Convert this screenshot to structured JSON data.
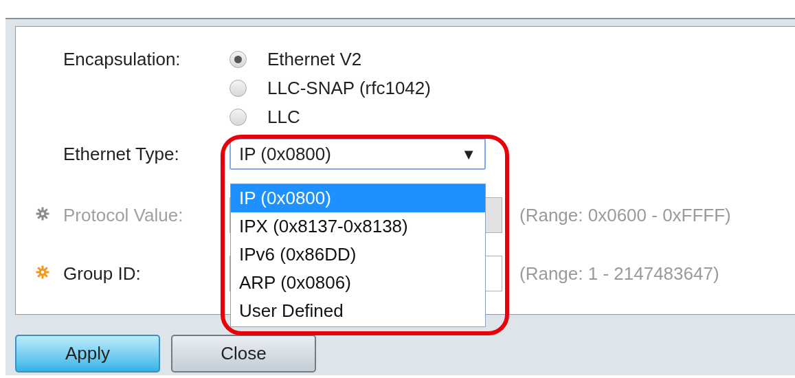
{
  "form": {
    "encapsulation": {
      "label": "Encapsulation:",
      "options": [
        {
          "label": "Ethernet V2",
          "selected": true
        },
        {
          "label": "LLC-SNAP (rfc1042)",
          "selected": false
        },
        {
          "label": "LLC",
          "selected": false
        }
      ]
    },
    "ethernet_type": {
      "label": "Ethernet Type:",
      "value": "IP (0x0800)",
      "arrow": "▼",
      "expanded": true,
      "options": [
        {
          "label": "IP (0x0800)",
          "selected": true
        },
        {
          "label": "IPX (0x8137-0x8138)",
          "selected": false
        },
        {
          "label": "IPv6 (0x86DD)",
          "selected": false
        },
        {
          "label": "ARP (0x0806)",
          "selected": false
        },
        {
          "label": "User Defined",
          "selected": false
        }
      ]
    },
    "fields": [
      {
        "label": "Protocol Value:",
        "required": true,
        "disabled": true,
        "hint": "(Range: 0x0600 - 0xFFFF)"
      },
      {
        "label": "Group ID:",
        "required": true,
        "disabled": false,
        "hint": "(Range: 1 - 2147483647)"
      }
    ]
  },
  "buttons": [
    {
      "label": "Apply",
      "kind": "primary"
    },
    {
      "label": "Close",
      "kind": "secondary"
    }
  ]
}
